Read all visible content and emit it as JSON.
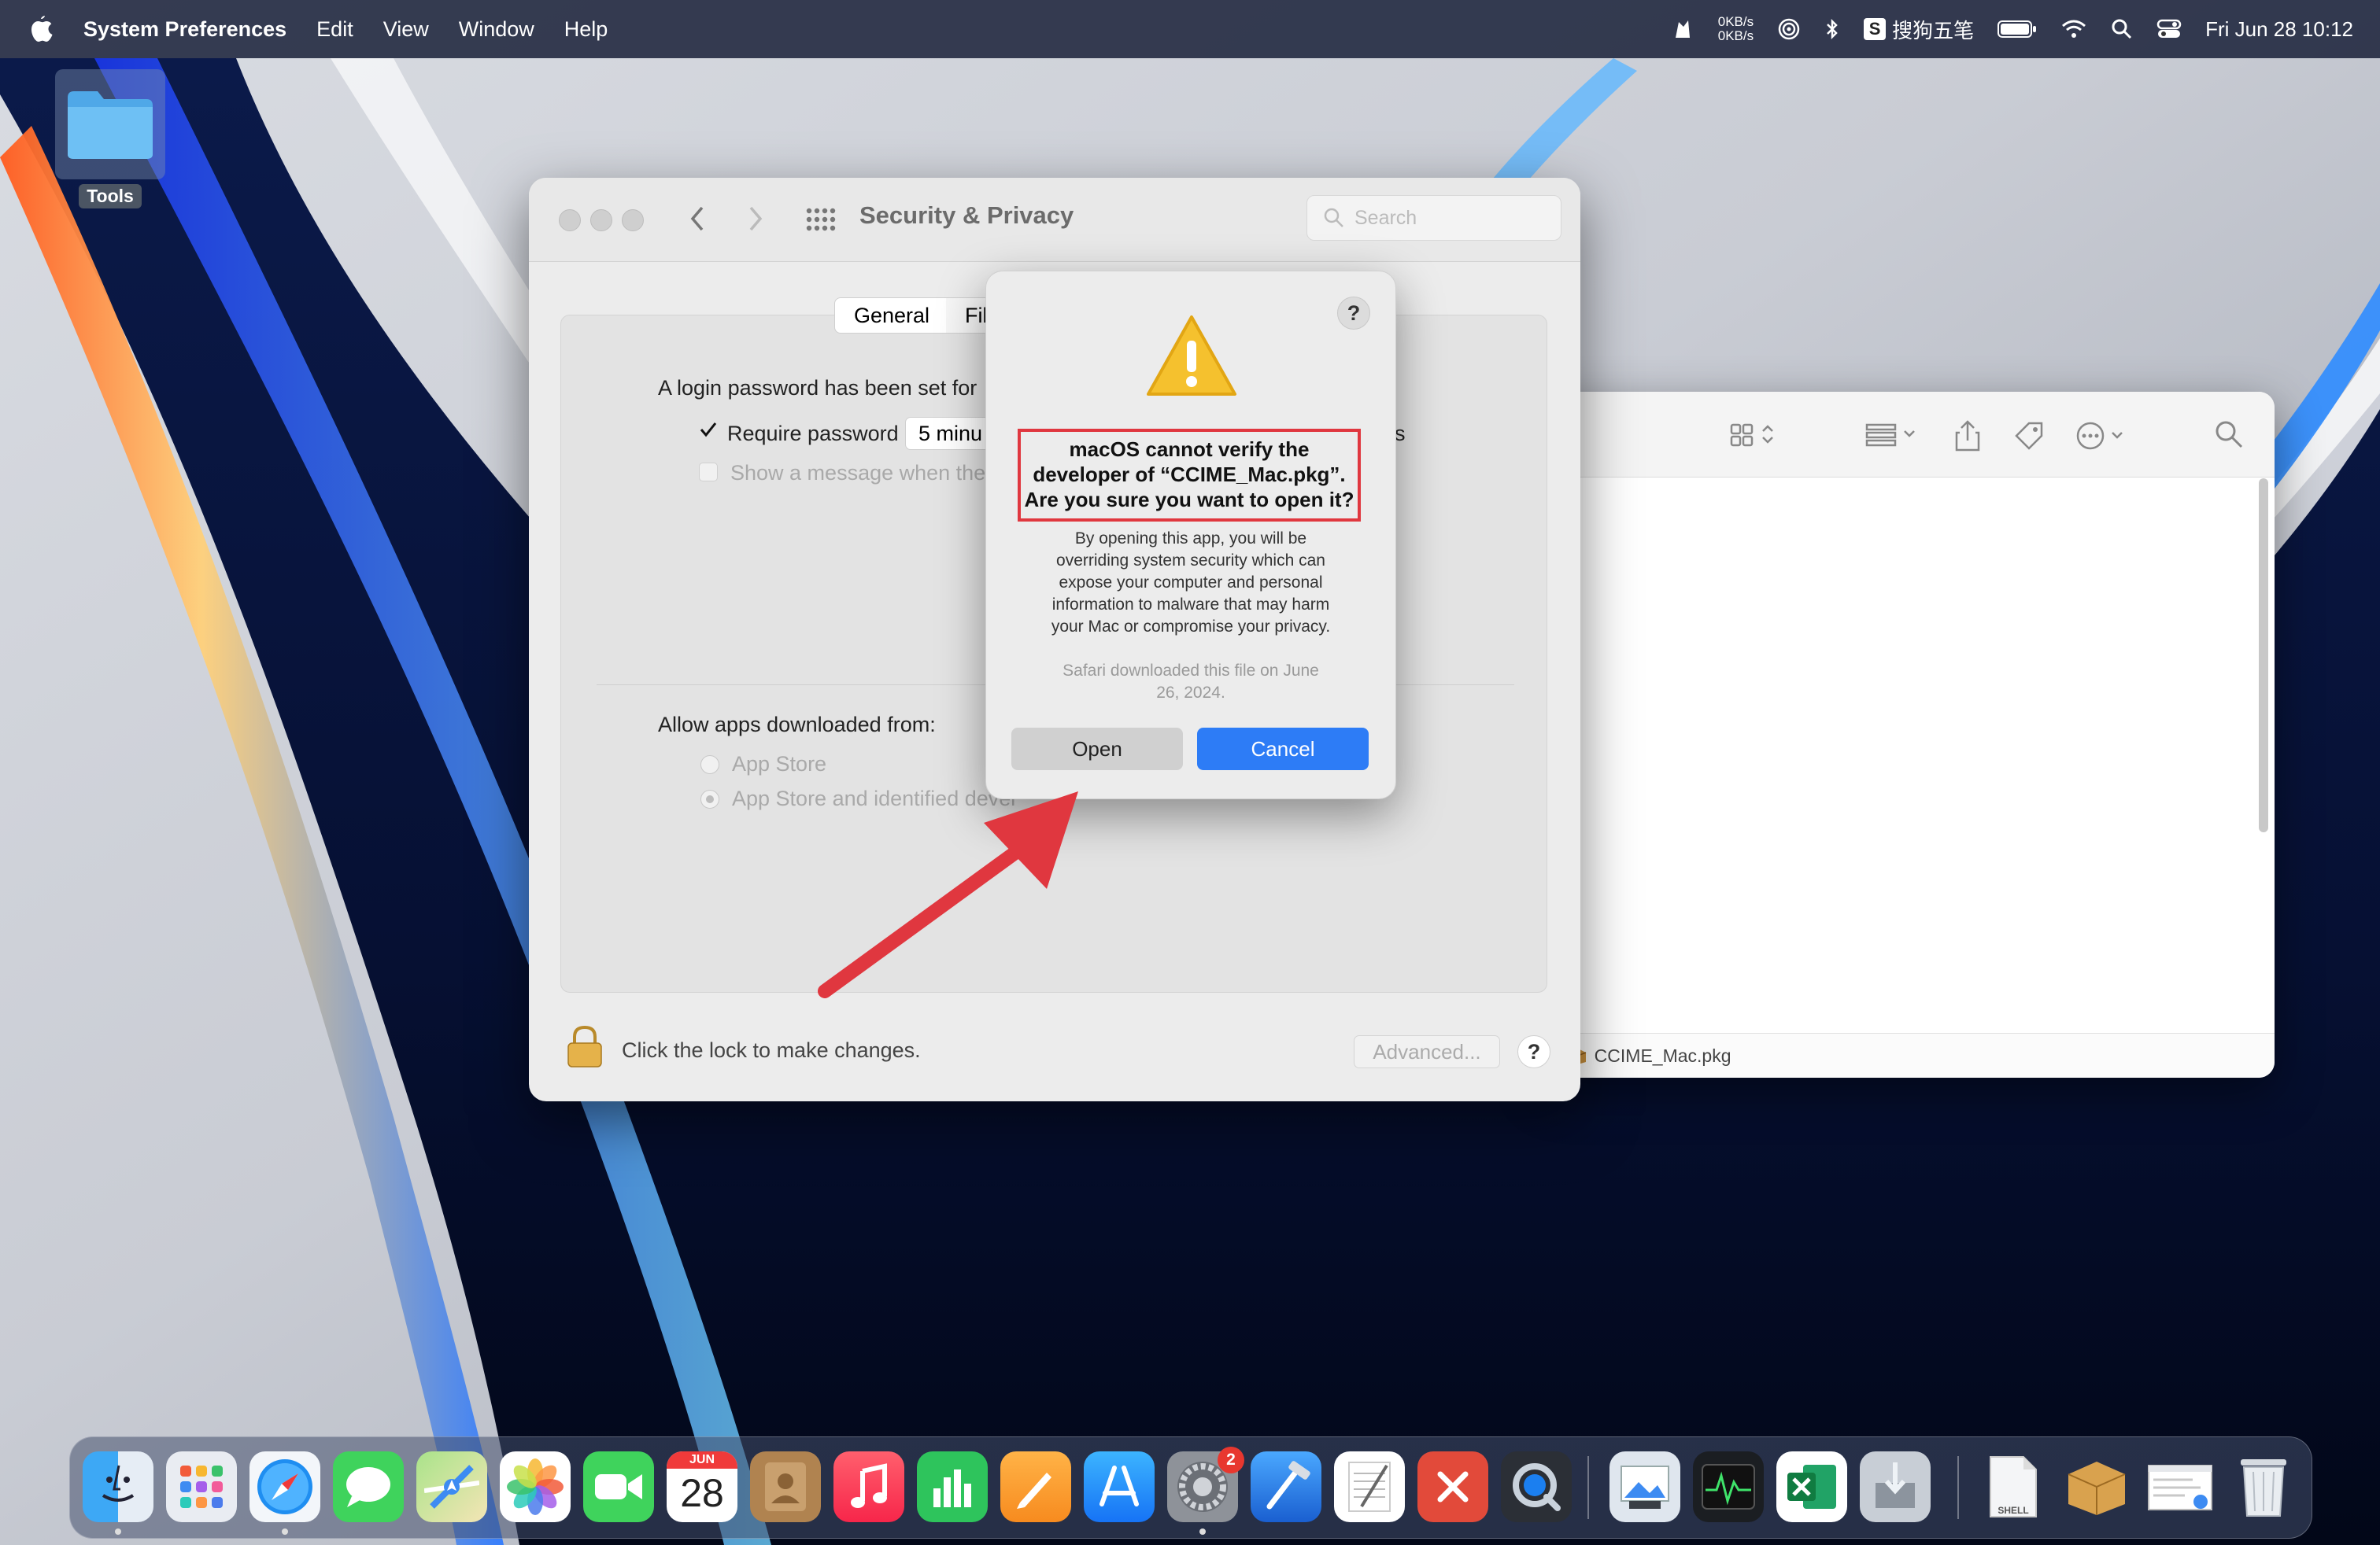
{
  "menubar": {
    "app_name": "System Preferences",
    "menus": [
      "Edit",
      "View",
      "Window",
      "Help"
    ],
    "net_up": "0KB/s",
    "net_down": "0KB/s",
    "input_method": "搜狗五笔",
    "datetime": "Fri Jun 28  10:12"
  },
  "desktop": {
    "folder_label": "Tools"
  },
  "finder": {
    "path_item": "CCIME_Mac.pkg",
    "path_sep": "›"
  },
  "sysprefs": {
    "title": "Security & Privacy",
    "search_placeholder": "Search",
    "tabs": [
      "General",
      "Fil"
    ],
    "login_text": "A login password has been set for",
    "require_password_label": "Require password",
    "require_password_value": "5 minu",
    "show_message_label": "Show a message when the",
    "truncated_s": "s",
    "allow_apps_label": "Allow apps downloaded from:",
    "options": [
      "App Store",
      "App Store and identified devel"
    ],
    "lock_text": "Click the lock to make changes.",
    "advanced_label": "Advanced...",
    "help": "?"
  },
  "alert": {
    "help": "?",
    "headline_lines": [
      "macOS cannot verify the",
      "developer of “CCIME_Mac.pkg”.",
      "Are you sure you want to open it?"
    ],
    "body_lines": [
      "By opening this app, you will be",
      "overriding system security which can",
      "expose your computer and personal",
      "information to malware that may harm",
      "your Mac or compromise your privacy."
    ],
    "note_lines": [
      "Safari downloaded this file on June",
      "26, 2024."
    ],
    "open_label": "Open",
    "cancel_label": "Cancel",
    "annotation_color": "#e0373f"
  },
  "dock": {
    "calendar_month": "JUN",
    "calendar_day": "28",
    "settings_badge": "2",
    "items": [
      "finder-icon",
      "launchpad-icon",
      "safari-icon",
      "messages-icon",
      "maps-icon",
      "photos-icon",
      "facetime-icon",
      "calendar-icon",
      "contacts-icon",
      "music-icon",
      "numbers-icon",
      "pages-icon",
      "app-store-icon",
      "system-preferences-icon",
      "xcode-icon",
      "textedit-icon",
      "remote-desktop-icon",
      "quicktime-icon",
      "preview-icon",
      "activity-monitor-icon",
      "excel-icon",
      "installer-icon",
      "shell-script-icon",
      "package-icon",
      "document-icon",
      "trash-icon"
    ],
    "shell_label": "SHELL"
  },
  "colors": {
    "accent_blue": "#2d7cf6",
    "annotation_red": "#e0373f"
  }
}
